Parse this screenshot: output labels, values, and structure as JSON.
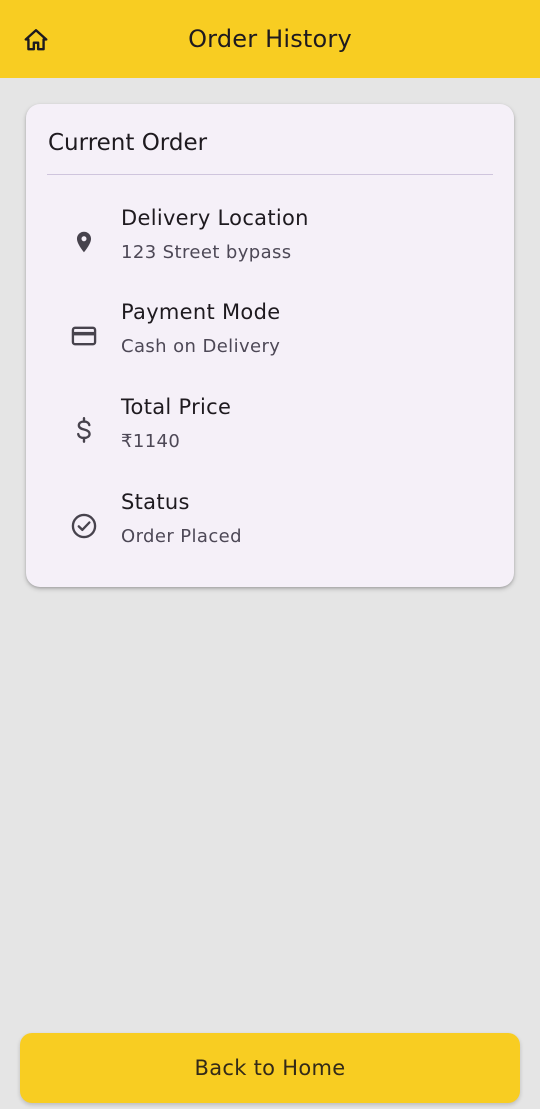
{
  "app_bar": {
    "title": "Order History",
    "home_icon": "home-icon",
    "background_color": "#f8cd22"
  },
  "card": {
    "title": "Current Order",
    "rows": [
      {
        "icon": "location-pin-icon",
        "label": "Delivery Location",
        "value": "123 Street bypass"
      },
      {
        "icon": "credit-card-icon",
        "label": "Payment Mode",
        "value": "Cash on Delivery"
      },
      {
        "icon": "dollar-icon",
        "label": "Total Price",
        "value": "₹1140"
      },
      {
        "icon": "check-circle-icon",
        "label": "Status",
        "value": "Order Placed"
      }
    ]
  },
  "footer": {
    "back_label": "Back to Home"
  }
}
